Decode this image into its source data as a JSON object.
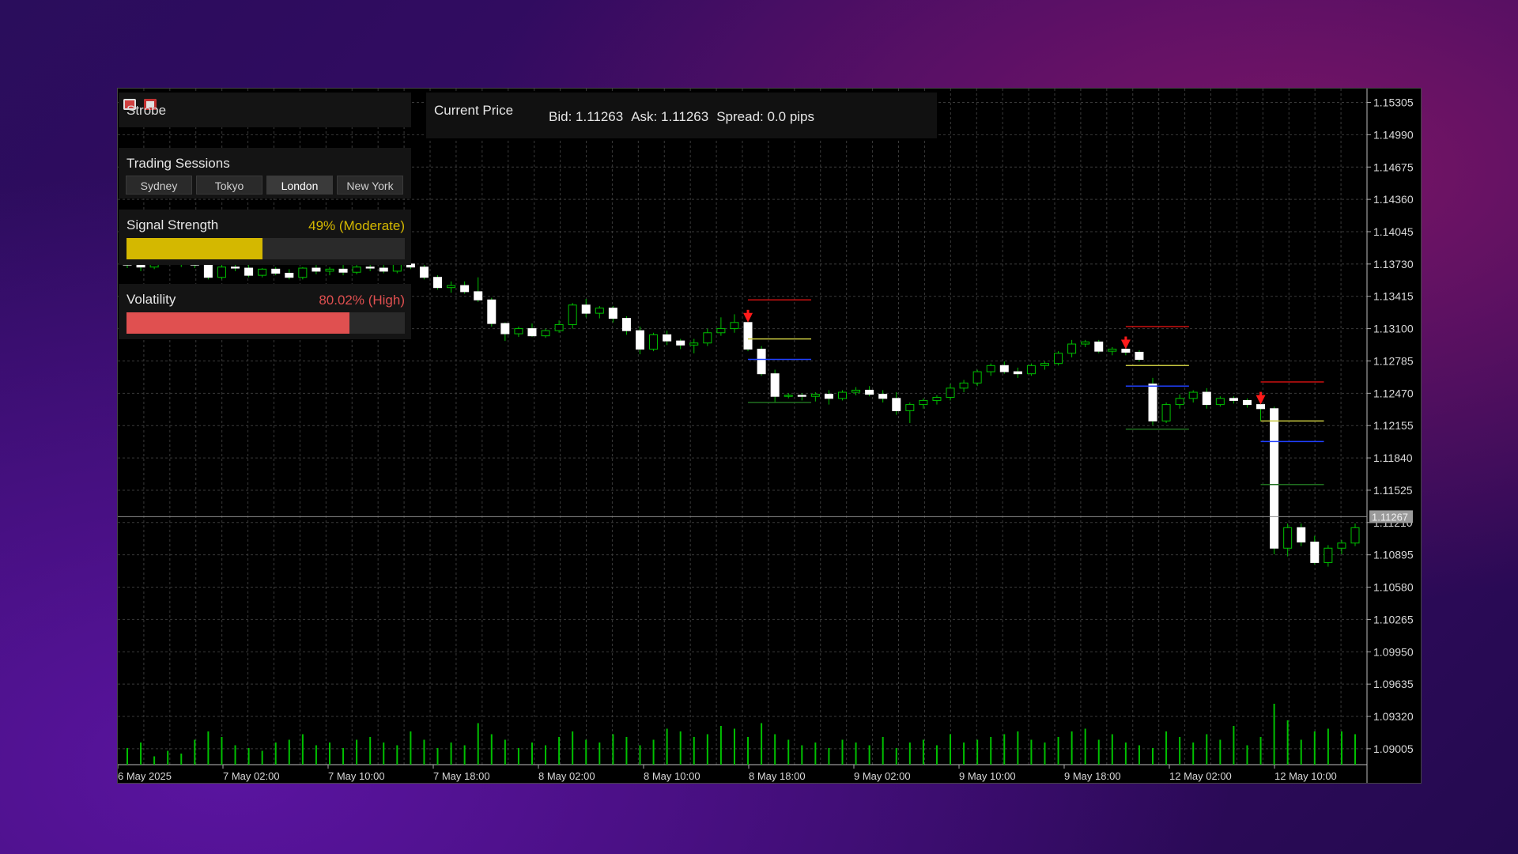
{
  "brand": {
    "name": "Strobe",
    "icons": [
      "sheet-icon",
      "chart-icon"
    ]
  },
  "price_panel": {
    "title": "Current Price",
    "bid": "Bid: 1.11263",
    "ask": "Ask: 1.11263",
    "spread": "Spread: 0.0 pips"
  },
  "sessions": {
    "title": "Trading Sessions",
    "items": [
      "Sydney",
      "Tokyo",
      "London",
      "New York"
    ],
    "active": "London"
  },
  "signal": {
    "label": "Signal Strength",
    "value_text": "49% (Moderate)",
    "percent": 49,
    "color": "#d4b800"
  },
  "volatility": {
    "label": "Volatility",
    "value_text": "80.02% (High)",
    "percent": 80.02,
    "color": "#e05050"
  },
  "colors": {
    "bull": "#ffffff",
    "bear": "#00c000",
    "volume": "#00c000",
    "sell_arrow": "#ff1a1a"
  },
  "chart_data": {
    "type": "candlestick",
    "current_price_label": "1.11267",
    "current_price": 1.11267,
    "y_ticks": [
      "1.15305",
      "1.14990",
      "1.14675",
      "1.14360",
      "1.14045",
      "1.13730",
      "1.13415",
      "1.13100",
      "1.12785",
      "1.12470",
      "1.12155",
      "1.11840",
      "1.11525",
      "1.11210",
      "1.10895",
      "1.10580",
      "1.10265",
      "1.09950",
      "1.09635",
      "1.09320",
      "1.09005"
    ],
    "ylim": [
      1.0885,
      1.1544
    ],
    "x_ticks": [
      "6 May 2025",
      "7 May 02:00",
      "7 May 10:00",
      "7 May 18:00",
      "8 May 02:00",
      "8 May 10:00",
      "8 May 18:00",
      "9 May 02:00",
      "9 May 10:00",
      "9 May 18:00",
      "12 May 02:00",
      "12 May 10:00"
    ],
    "candles": [
      [
        1.1376,
        1.138,
        1.1369,
        1.1372
      ],
      [
        1.1372,
        1.1377,
        1.1366,
        1.137
      ],
      [
        1.137,
        1.1378,
        1.1368,
        1.1375
      ],
      [
        1.1375,
        1.1379,
        1.1372,
        1.1373
      ],
      [
        1.1373,
        1.138,
        1.137,
        1.1376
      ],
      [
        1.1376,
        1.1379,
        1.1369,
        1.1372
      ],
      [
        1.1372,
        1.1373,
        1.1358,
        1.136
      ],
      [
        1.136,
        1.1372,
        1.1358,
        1.137
      ],
      [
        1.137,
        1.1376,
        1.1366,
        1.1369
      ],
      [
        1.1369,
        1.1372,
        1.136,
        1.1362
      ],
      [
        1.1362,
        1.1369,
        1.136,
        1.1368
      ],
      [
        1.1368,
        1.137,
        1.1362,
        1.1364
      ],
      [
        1.1364,
        1.1368,
        1.1358,
        1.136
      ],
      [
        1.136,
        1.137,
        1.1358,
        1.1369
      ],
      [
        1.1369,
        1.1372,
        1.1363,
        1.1366
      ],
      [
        1.1366,
        1.137,
        1.1362,
        1.1368
      ],
      [
        1.1368,
        1.1372,
        1.1362,
        1.1365
      ],
      [
        1.1365,
        1.1372,
        1.1363,
        1.137
      ],
      [
        1.137,
        1.1374,
        1.1366,
        1.1369
      ],
      [
        1.1369,
        1.1372,
        1.1364,
        1.1366
      ],
      [
        1.1366,
        1.1375,
        1.1364,
        1.1373
      ],
      [
        1.1373,
        1.1378,
        1.1368,
        1.137
      ],
      [
        1.137,
        1.1372,
        1.1358,
        1.136
      ],
      [
        1.136,
        1.1362,
        1.1348,
        1.135
      ],
      [
        1.135,
        1.1356,
        1.1345,
        1.1352
      ],
      [
        1.1352,
        1.1356,
        1.1344,
        1.1346
      ],
      [
        1.1346,
        1.136,
        1.1336,
        1.1338
      ],
      [
        1.1338,
        1.134,
        1.1312,
        1.1315
      ],
      [
        1.1315,
        1.1316,
        1.1298,
        1.1305
      ],
      [
        1.1305,
        1.1312,
        1.1302,
        1.131
      ],
      [
        1.131,
        1.1315,
        1.1302,
        1.1303
      ],
      [
        1.1303,
        1.131,
        1.1301,
        1.1308
      ],
      [
        1.1308,
        1.1318,
        1.1306,
        1.1314
      ],
      [
        1.1314,
        1.1335,
        1.131,
        1.1333
      ],
      [
        1.1333,
        1.1339,
        1.1321,
        1.1325
      ],
      [
        1.1325,
        1.1332,
        1.132,
        1.133
      ],
      [
        1.133,
        1.1332,
        1.1316,
        1.132
      ],
      [
        1.132,
        1.1322,
        1.1304,
        1.1308
      ],
      [
        1.1308,
        1.1312,
        1.1285,
        1.129
      ],
      [
        1.129,
        1.1306,
        1.1288,
        1.1304
      ],
      [
        1.1304,
        1.1308,
        1.1294,
        1.1298
      ],
      [
        1.1298,
        1.13,
        1.129,
        1.1294
      ],
      [
        1.1294,
        1.13,
        1.1286,
        1.1296
      ],
      [
        1.1296,
        1.131,
        1.1293,
        1.1306
      ],
      [
        1.1306,
        1.1321,
        1.1303,
        1.131
      ],
      [
        1.131,
        1.1324,
        1.1306,
        1.1316
      ],
      [
        1.1316,
        1.132,
        1.1288,
        1.129
      ],
      [
        1.129,
        1.1293,
        1.1264,
        1.1266
      ],
      [
        1.1266,
        1.127,
        1.1238,
        1.1244
      ],
      [
        1.1244,
        1.1247,
        1.1242,
        1.1245
      ],
      [
        1.1245,
        1.1247,
        1.124,
        1.1244
      ],
      [
        1.1244,
        1.1248,
        1.1239,
        1.1246
      ],
      [
        1.1246,
        1.125,
        1.1236,
        1.1242
      ],
      [
        1.1242,
        1.125,
        1.124,
        1.1248
      ],
      [
        1.1248,
        1.1253,
        1.1245,
        1.125
      ],
      [
        1.125,
        1.1254,
        1.1244,
        1.1246
      ],
      [
        1.1246,
        1.125,
        1.1238,
        1.1242
      ],
      [
        1.1242,
        1.1248,
        1.1226,
        1.123
      ],
      [
        1.123,
        1.1238,
        1.1218,
        1.1236
      ],
      [
        1.1236,
        1.1242,
        1.1232,
        1.124
      ],
      [
        1.124,
        1.1245,
        1.1236,
        1.1243
      ],
      [
        1.1243,
        1.1256,
        1.124,
        1.1252
      ],
      [
        1.1252,
        1.126,
        1.1248,
        1.1257
      ],
      [
        1.1257,
        1.127,
        1.1254,
        1.1268
      ],
      [
        1.1268,
        1.1276,
        1.1264,
        1.1274
      ],
      [
        1.1274,
        1.1278,
        1.1266,
        1.1268
      ],
      [
        1.1268,
        1.1272,
        1.1262,
        1.1266
      ],
      [
        1.1266,
        1.1276,
        1.1264,
        1.1274
      ],
      [
        1.1274,
        1.1278,
        1.127,
        1.1276
      ],
      [
        1.1276,
        1.1288,
        1.1274,
        1.1286
      ],
      [
        1.1286,
        1.1299,
        1.1282,
        1.1295
      ],
      [
        1.1295,
        1.1299,
        1.1292,
        1.1297
      ],
      [
        1.1297,
        1.1299,
        1.1286,
        1.1288
      ],
      [
        1.1288,
        1.1292,
        1.1284,
        1.129
      ],
      [
        1.129,
        1.1292,
        1.1284,
        1.1287
      ],
      [
        1.1287,
        1.1289,
        1.1278,
        1.128
      ],
      [
        1.1256,
        1.1262,
        1.1216,
        1.122
      ],
      [
        1.122,
        1.1238,
        1.1218,
        1.1236
      ],
      [
        1.1236,
        1.1246,
        1.1232,
        1.1242
      ],
      [
        1.1242,
        1.125,
        1.1238,
        1.1248
      ],
      [
        1.1248,
        1.1252,
        1.1232,
        1.1236
      ],
      [
        1.1236,
        1.1244,
        1.1234,
        1.1242
      ],
      [
        1.1242,
        1.1244,
        1.1237,
        1.124
      ],
      [
        1.124,
        1.1242,
        1.1233,
        1.1236
      ],
      [
        1.1236,
        1.1244,
        1.122,
        1.1232
      ],
      [
        1.1232,
        1.1234,
        1.109,
        1.1096
      ],
      [
        1.1096,
        1.112,
        1.1088,
        1.1116
      ],
      [
        1.1116,
        1.112,
        1.1098,
        1.1102
      ],
      [
        1.1102,
        1.1108,
        1.108,
        1.1082
      ],
      [
        1.1082,
        1.1099,
        1.1078,
        1.1096
      ],
      [
        1.1096,
        1.1104,
        1.109,
        1.1101
      ],
      [
        1.1101,
        1.112,
        1.1098,
        1.1116
      ]
    ],
    "volume": [
      6,
      8,
      3,
      5,
      4,
      9,
      12,
      10,
      7,
      6,
      5,
      8,
      9,
      11,
      7,
      8,
      6,
      9,
      10,
      8,
      7,
      12,
      9,
      6,
      8,
      7,
      15,
      11,
      9,
      6,
      8,
      7,
      10,
      12,
      9,
      8,
      11,
      10,
      7,
      9,
      13,
      12,
      10,
      11,
      14,
      13,
      10,
      15,
      11,
      9,
      7,
      8,
      6,
      9,
      8,
      7,
      10,
      6,
      8,
      9,
      7,
      11,
      8,
      9,
      10,
      11,
      12,
      9,
      8,
      10,
      12,
      13,
      9,
      11,
      8,
      7,
      6,
      12,
      10,
      8,
      11,
      9,
      14,
      7,
      10,
      22,
      16,
      9,
      12,
      13,
      12,
      11
    ]
  },
  "levels": [
    {
      "from": 1.1291,
      "to": 1.1312,
      "x0": 48,
      "x1": 53
    }
  ]
}
